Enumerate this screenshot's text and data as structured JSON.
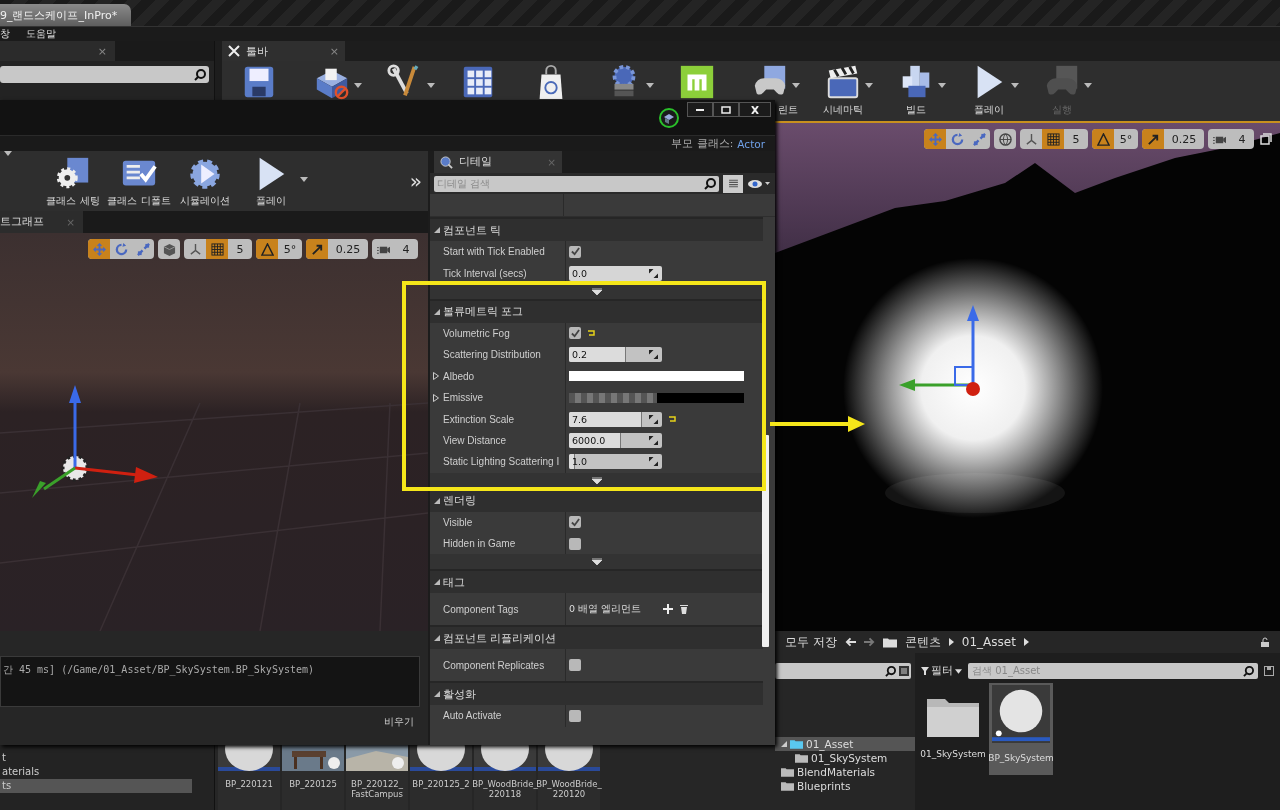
{
  "window": {
    "title": "9_랜드스케이프_InPro*"
  },
  "menu": [
    "창",
    "도움말"
  ],
  "left_panel": {
    "close": "×",
    "tree": [
      {
        "label": "t",
        "selected": false
      },
      {
        "label": "aterials",
        "selected": false
      },
      {
        "label": "ts",
        "selected": true
      }
    ]
  },
  "toolbar": {
    "tab": "툴바",
    "close": "×",
    "items": [
      {
        "kind": "floppy",
        "dropdown": false,
        "disabled": false
      },
      {
        "kind": "box",
        "dropdown": true,
        "disabled": false
      },
      {
        "kind": "tools",
        "dropdown": true,
        "disabled": false
      },
      {
        "kind": "grid",
        "dropdown": false,
        "disabled": false
      },
      {
        "kind": "bag",
        "dropdown": false,
        "disabled": false
      },
      {
        "kind": "gear",
        "dropdown": true,
        "disabled": false
      },
      {
        "kind": "logo",
        "dropdown": false,
        "disabled": false
      },
      {
        "kind": "gamepad",
        "label": "린트",
        "dropdown": true,
        "disabled": false
      },
      {
        "kind": "clapper",
        "label": "시네마틱",
        "dropdown": true,
        "disabled": false
      },
      {
        "kind": "blocks",
        "label": "빌드",
        "dropdown": true,
        "disabled": false
      },
      {
        "kind": "play",
        "label": "플레이",
        "dropdown": true,
        "disabled": false
      },
      {
        "kind": "monitor",
        "label": "실행",
        "dropdown": true,
        "disabled": true
      }
    ]
  },
  "level_viewport": {
    "toolbar": {
      "transform": [
        {
          "kind": "move",
          "selected": true
        },
        {
          "kind": "rotate",
          "selected": false
        },
        {
          "kind": "scale",
          "selected": false
        }
      ],
      "grid_snap": true,
      "grid": "5",
      "angle_snap": true,
      "angle": "5°",
      "scale_snap": true,
      "scale": "0.25",
      "speed": "4"
    }
  },
  "content_browser": {
    "save_all": "모두 저장",
    "path": [
      "콘텐츠",
      "01_Asset"
    ],
    "filter": "필터",
    "search_placeholder": "검색 01_Asset",
    "tree": [
      {
        "label": "01_Asset",
        "selected": true,
        "expanded": true,
        "children": [
          {
            "label": "01_SkySystem",
            "selected": false
          }
        ]
      },
      {
        "label": "BlendMaterials",
        "selected": false
      },
      {
        "label": "Blueprints",
        "selected": false
      }
    ],
    "assets": [
      {
        "name": "01_SkySystem",
        "kind": "folder",
        "selected": false
      },
      {
        "name": "BP_SkySystem",
        "kind": "blueprint",
        "selected": true
      }
    ]
  },
  "asset_strip": [
    {
      "lines": [
        "BP_220121"
      ],
      "kind": "sphere"
    },
    {
      "lines": [
        "BP_220125"
      ],
      "kind": "table"
    },
    {
      "lines": [
        "BP_220122_",
        "FastCampus"
      ],
      "kind": "floor"
    },
    {
      "lines": [
        "BP_220125_2"
      ],
      "kind": "sphere"
    },
    {
      "lines": [
        "BP_WoodBride_",
        "220118"
      ],
      "kind": "sphere"
    },
    {
      "lines": [
        "BP_WoodBride_",
        "220120"
      ],
      "kind": "sphere"
    }
  ],
  "blueprint_window": {
    "parent_label": "부모 클래스:",
    "parent_value": "Actor",
    "toolbar": [
      {
        "kind": "class-settings",
        "label": "클래스 세팅",
        "dropdown": false
      },
      {
        "kind": "class-defaults",
        "label": "클래스 디폴트",
        "dropdown": false
      },
      {
        "kind": "simulate",
        "label": "시뮬레이션",
        "dropdown": false
      },
      {
        "kind": "play",
        "label": "플레이",
        "dropdown": true
      }
    ],
    "overflow": "»",
    "graph_tab": "트그래프",
    "graph_close": "×",
    "viewport_toolbar": {
      "transform": [
        {
          "kind": "move",
          "selected": true
        },
        {
          "kind": "rotate",
          "selected": false
        },
        {
          "kind": "scale",
          "selected": false
        }
      ],
      "grid_snap": true,
      "grid": "5",
      "angle_snap": true,
      "angle": "5°",
      "scale_snap": true,
      "scale": "0.25",
      "speed": "4"
    },
    "log": {
      "text": "간 45 ms] (/Game/01_Asset/BP_SkySystem.BP_SkySystem)",
      "clear": "비우기"
    },
    "details": {
      "tab": "디테일",
      "close": "×",
      "search_placeholder": "디테일 검색",
      "categories": [
        {
          "title": "컴포넌트 틱",
          "expanded": true,
          "more": true,
          "rows": [
            {
              "label": "Start with Tick Enabled",
              "kind": "checkbox",
              "checked": true,
              "reset": false
            },
            {
              "label": "Tick Interval (secs)",
              "kind": "number",
              "value": "0.0",
              "reset": false
            }
          ]
        },
        {
          "title": "볼류메트릭 포그",
          "expanded": true,
          "more": true,
          "rows": [
            {
              "label": "Volumetric Fog",
              "kind": "checkbox",
              "checked": true,
              "reset": true
            },
            {
              "label": "Scattering Distribution",
              "kind": "number",
              "value": "0.2",
              "level": 0.6,
              "reset": false
            },
            {
              "label": "Albedo",
              "kind": "color",
              "color": "#ffffff",
              "transparent": false,
              "expanded": false,
              "reset": false
            },
            {
              "label": "Emissive",
              "kind": "color",
              "color": "#000000",
              "transparent": true,
              "expanded": false,
              "reset": false
            },
            {
              "label": "Extinction Scale",
              "kind": "number",
              "value": "7.6",
              "level": 0.77,
              "reset": true
            },
            {
              "label": "View Distance",
              "kind": "number",
              "value": "6000.0",
              "level": 0.55,
              "reset": false
            },
            {
              "label": "Static Lighting Scattering I",
              "kind": "number",
              "value": "1.0",
              "level": 0.05,
              "reset": false
            }
          ]
        },
        {
          "title": "렌더링",
          "expanded": true,
          "more": true,
          "rows": [
            {
              "label": "Visible",
              "kind": "checkbox",
              "checked": true,
              "reset": false
            },
            {
              "label": "Hidden in Game",
              "kind": "checkbox",
              "checked": false,
              "reset": false
            }
          ]
        },
        {
          "title": "태그",
          "expanded": true,
          "more": false,
          "rows": [
            {
              "label": "Component Tags",
              "kind": "array",
              "value": "0 배열 엘리먼트",
              "reset": false
            }
          ]
        },
        {
          "title": "컴포넌트 리플리케이션",
          "expanded": true,
          "more": false,
          "rows": [
            {
              "label": "Component Replicates",
              "kind": "checkbox",
              "checked": false,
              "reset": false
            }
          ]
        },
        {
          "title": "활성화",
          "expanded": true,
          "more": false,
          "rows": [
            {
              "label": "Auto Activate",
              "kind": "checkbox",
              "checked": false,
              "reset": false
            }
          ]
        }
      ]
    }
  }
}
